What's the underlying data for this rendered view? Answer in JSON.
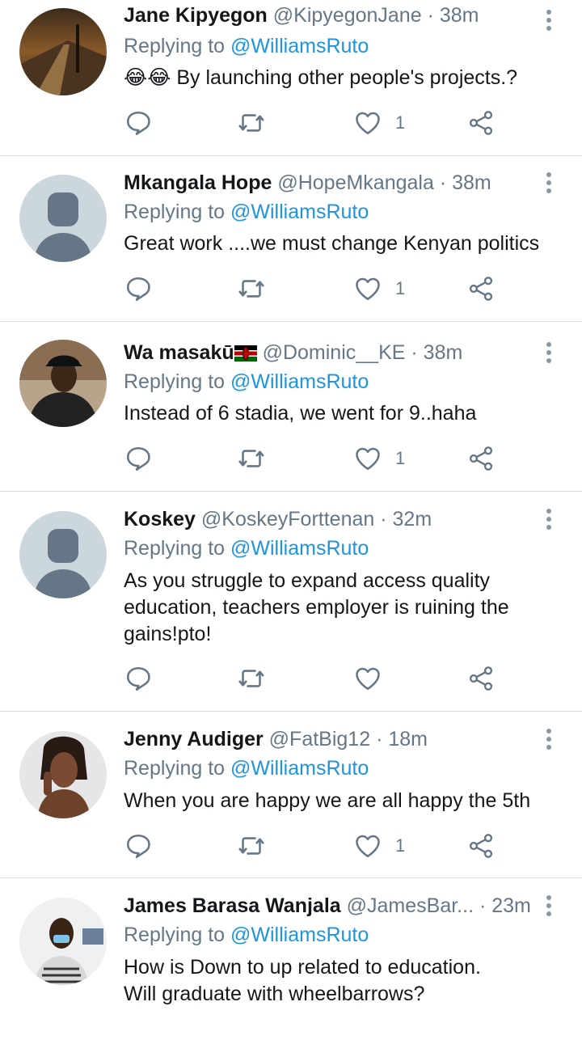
{
  "replying_prefix": "Replying to",
  "tweets": [
    {
      "name": "Jane Kipyegon",
      "handle": "@KipyegonJane",
      "sep": "·",
      "time": "38m",
      "reply_to": "@WilliamsRuto",
      "text": "😂😂 By launching other people's projects.?",
      "likes": "1",
      "avatar": "photo-road"
    },
    {
      "name": "Mkangala Hope",
      "handle": "@HopeMkangala",
      "sep": "·",
      "time": "38m",
      "reply_to": "@WilliamsRuto",
      "text": "Great work ....we must change Kenyan politics",
      "likes": "1",
      "avatar": "default-person"
    },
    {
      "name": "Wa masakū",
      "handle": "@Dominic__KE",
      "sep": "·",
      "time": "38m",
      "reply_to": "@WilliamsRuto",
      "text": "Instead of 6 stadia, we went for 9..haha",
      "likes": "1",
      "avatar": "photo-man-cap",
      "flag": "kenya-flag"
    },
    {
      "name": "Koskey",
      "handle": "@KoskeyForttenan",
      "sep": "·",
      "time": "32m",
      "reply_to": "@WilliamsRuto",
      "text": "As you struggle to expand access quality education, teachers employer is ruining the gains!pto!",
      "likes": "",
      "avatar": "default-person"
    },
    {
      "name": "Jenny Audiger",
      "handle": "@FatBig12",
      "sep": "·",
      "time": "18m",
      "reply_to": "@WilliamsRuto",
      "text": "When you are happy we are all happy the 5th",
      "likes": "1",
      "avatar": "photo-woman"
    },
    {
      "name": "James Barasa Wanjala",
      "handle": "@JamesBar...",
      "sep": "·",
      "time": "23m",
      "reply_to": "@WilliamsRuto",
      "text": "How is Down to up related to education. Will graduate with wheelbarrows?",
      "likes": "",
      "avatar": "photo-man-mask"
    }
  ],
  "colors": {
    "link": "#1b95e0",
    "muted": "#657786",
    "divider": "#d9dee2",
    "icon": "#657786"
  }
}
